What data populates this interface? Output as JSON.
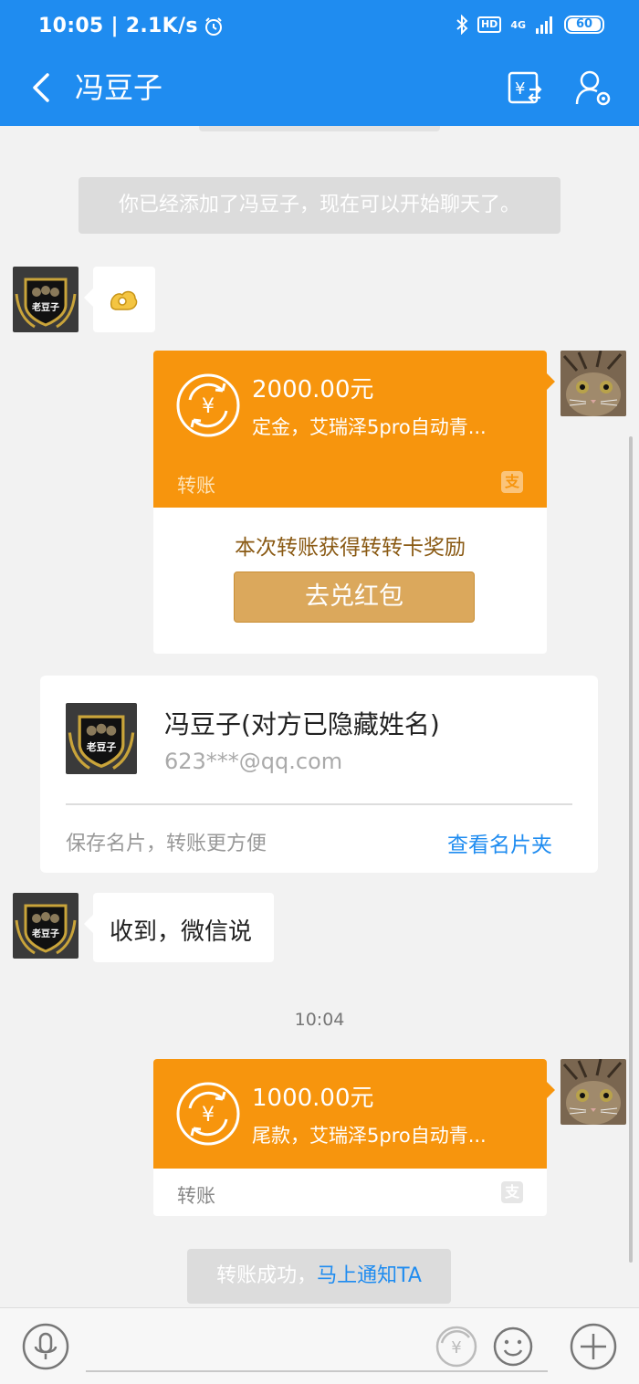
{
  "status_bar": {
    "time_speed": "10:05 | 2.1K/s",
    "hd": "HD",
    "network": "4G",
    "battery": "60"
  },
  "nav": {
    "title": "冯豆子"
  },
  "chat": {
    "system_added": "你已经添加了冯豆子，现在可以开始聊天了。",
    "transfer1": {
      "amount": "2000.00元",
      "description": "定金，艾瑞泽5pro自动青...",
      "label": "转账",
      "reward_text": "本次转账获得转转卡奖励",
      "redeem_button": "去兑红包"
    },
    "namecard": {
      "name": "冯豆子(对方已隐藏姓名)",
      "email": "623***@qq.com",
      "save_hint": "保存名片，转账更方便",
      "view_link": "查看名片夹"
    },
    "text_message": "收到，微信说",
    "timestamp": "10:04",
    "transfer2": {
      "amount": "1000.00元",
      "description": "尾款，艾瑞泽5pro自动青...",
      "label": "转账"
    },
    "success": {
      "text": "转账成功，",
      "link": "马上通知TA"
    }
  },
  "avatar_text": "老豆子",
  "colors": {
    "primary_blue": "#1f8cf0",
    "transfer_orange": "#f7950d",
    "redeem_gold": "#dba85c"
  }
}
